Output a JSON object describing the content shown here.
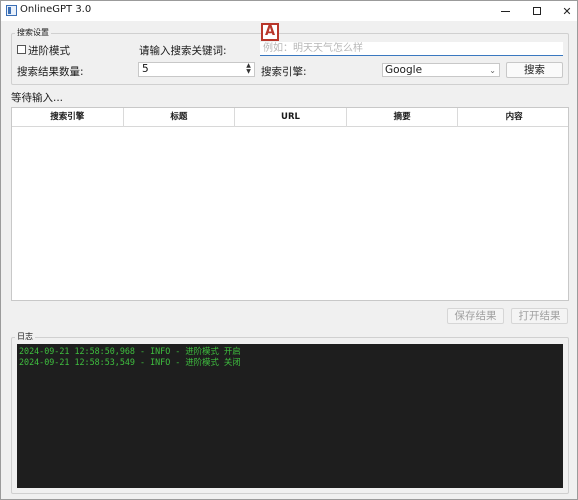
{
  "window": {
    "title": "OnlineGPT 3.0",
    "controls": {
      "minimize": "—",
      "maximize": "□",
      "close": "✕"
    }
  },
  "search_settings": {
    "group_title": "搜索设置",
    "advanced_mode_label": "进阶模式",
    "advanced_mode_checked": false,
    "keyword_label": "请输入搜索关键词:",
    "keyword_placeholder": "例如：明天天气怎么样",
    "result_count_label": "搜索结果数量:",
    "result_count_value": "5",
    "engine_label": "搜索引擎:",
    "engine_selected": "Google",
    "search_button": "搜索"
  },
  "annotation_marker": "A",
  "status_text": "等待输入...",
  "results_table": {
    "columns": [
      "搜索引擎",
      "标题",
      "URL",
      "摘要",
      "内容"
    ],
    "rows": []
  },
  "actions": {
    "save_button": "保存结果",
    "open_button": "打开结果"
  },
  "log": {
    "group_title": "日志",
    "lines": [
      "2024-09-21 12:58:50,968 - INFO - 进阶模式 开启",
      "2024-09-21 12:58:53,549 - INFO - 进阶模式 关闭"
    ],
    "text_color": "#3fbf3f",
    "background": "#1e1e1e"
  },
  "colors": {
    "accent": "#3a78c0",
    "annotation": "#b8362a"
  }
}
